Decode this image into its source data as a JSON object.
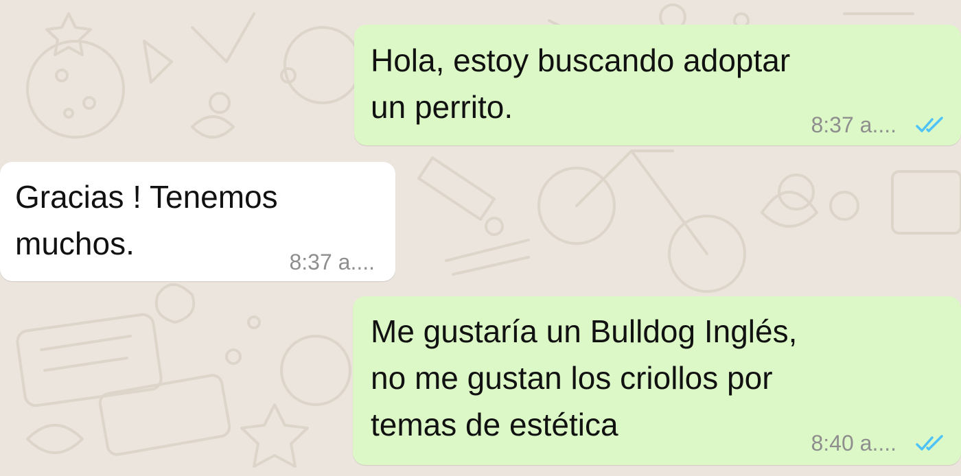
{
  "chat": {
    "colors": {
      "background": "#ECE5DD",
      "outgoing_bubble": "#DCF8C6",
      "incoming_bubble": "#FFFFFF",
      "read_ticks": "#4FC3F7"
    },
    "messages": [
      {
        "direction": "outgoing",
        "text": "Hola, estoy buscando adoptar\nun perrito.",
        "time": "8:37 a....",
        "status_icon": "double-check-read-icon"
      },
      {
        "direction": "incoming",
        "text": "Gracias ! Tenemos\nmuchos.",
        "time": "8:37 a...."
      },
      {
        "direction": "outgoing",
        "text": "Me gustaría un Bulldog Inglés,\nno me gustan los criollos por\ntemas de estética",
        "time": "8:40 a....",
        "status_icon": "double-check-read-icon"
      }
    ]
  }
}
